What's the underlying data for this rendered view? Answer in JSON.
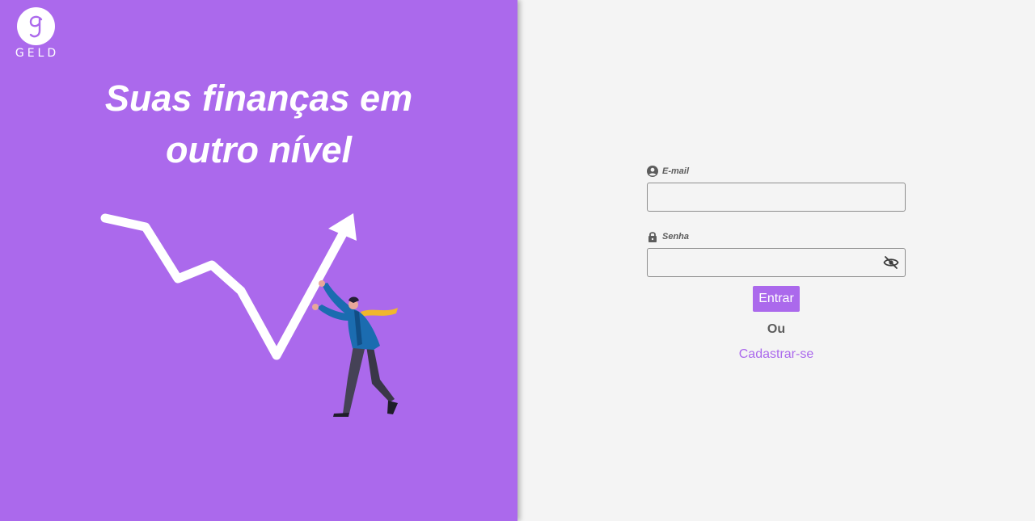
{
  "brand": {
    "logo_letter": "g",
    "name": "GELD"
  },
  "hero": {
    "headline_line1": "Suas finanças em",
    "headline_line2": "outro nível",
    "illustration": "businessman-pushing-growth-arrow"
  },
  "form": {
    "email": {
      "label": "E-mail",
      "value": "",
      "icon": "user-circle-icon"
    },
    "password": {
      "label": "Senha",
      "value": "",
      "icon": "lock-icon",
      "toggle_icon": "eye-off-icon"
    },
    "submit_label": "Entrar",
    "or_text": "Ou",
    "signup_label": "Cadastrar-se"
  },
  "colors": {
    "brand_purple": "#ab69ec",
    "background": "#f4f4f4",
    "label_gray": "#5c5c5c",
    "input_border": "#8e8e8e"
  }
}
